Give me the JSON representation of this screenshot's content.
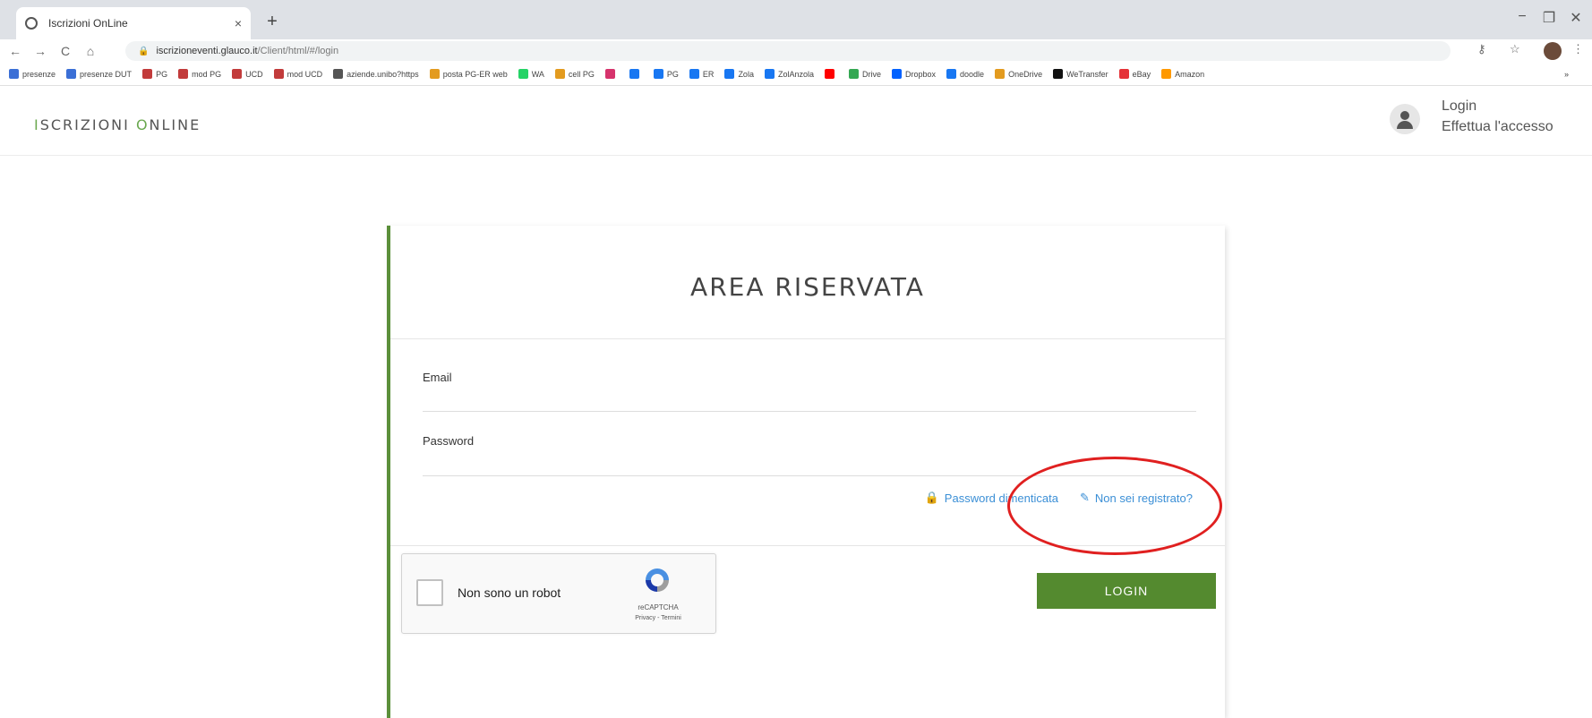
{
  "browser": {
    "tab_title": "Iscrizioni OnLine",
    "tab_close": "×",
    "new_tab": "+",
    "url_host": "iscrizioneventi.glauco.it",
    "url_path": "/Client/html/#/login",
    "window_controls": [
      "−",
      "❐",
      "✕"
    ],
    "nav": [
      "←",
      "→",
      "C",
      "⌂"
    ],
    "bookmarks": [
      {
        "label": "presenze",
        "color": "#3b6fd6"
      },
      {
        "label": "presenze DUT",
        "color": "#3b6fd6"
      },
      {
        "label": "PG",
        "color": "#c23b3b"
      },
      {
        "label": "mod PG",
        "color": "#c23b3b"
      },
      {
        "label": "UCD",
        "color": "#c23b3b"
      },
      {
        "label": "mod UCD",
        "color": "#c23b3b"
      },
      {
        "label": "aziende.unibo?https",
        "color": "#555555"
      },
      {
        "label": "posta PG-ER web",
        "color": "#e39b1f"
      },
      {
        "label": "WA",
        "color": "#25d366"
      },
      {
        "label": "cell PG",
        "color": "#e39b1f"
      },
      {
        "label": "",
        "color": "#d6336c"
      },
      {
        "label": "",
        "color": "#1877f2"
      },
      {
        "label": "PG",
        "color": "#1877f2"
      },
      {
        "label": "ER",
        "color": "#1877f2"
      },
      {
        "label": "Zola",
        "color": "#1877f2"
      },
      {
        "label": "ZolAnzola",
        "color": "#1877f2"
      },
      {
        "label": "",
        "color": "#ff0000"
      },
      {
        "label": "Drive",
        "color": "#34a853"
      },
      {
        "label": "Dropbox",
        "color": "#0061ff"
      },
      {
        "label": "doodle",
        "color": "#1877f2"
      },
      {
        "label": "OneDrive",
        "color": "#e39b1f"
      },
      {
        "label": "WeTransfer",
        "color": "#111111"
      },
      {
        "label": "eBay",
        "color": "#e53238"
      },
      {
        "label": "Amazon",
        "color": "#ff9900"
      }
    ],
    "more_bookmarks": "»"
  },
  "header": {
    "brand_first_letter": "I",
    "brand_part1": "SCRIZIONI ",
    "brand_second_letter": "O",
    "brand_part2": "NLINE",
    "login_label": "Login",
    "login_sub": "Effettua l'accesso"
  },
  "card": {
    "title": "AREA RISERVATA",
    "email_label": "Email",
    "email_value": "",
    "password_label": "Password",
    "password_value": "",
    "forgot_password": "Password dimenticata",
    "not_registered": "Non sei registrato?",
    "login_button": "LOGIN"
  },
  "recaptcha": {
    "label": "Non sono un robot",
    "brand": "reCAPTCHA",
    "terms": "Privacy - Termini"
  },
  "colors": {
    "accent_green": "#548a2f",
    "link_blue": "#3b8fd6",
    "annotation_red": "#e02020"
  }
}
